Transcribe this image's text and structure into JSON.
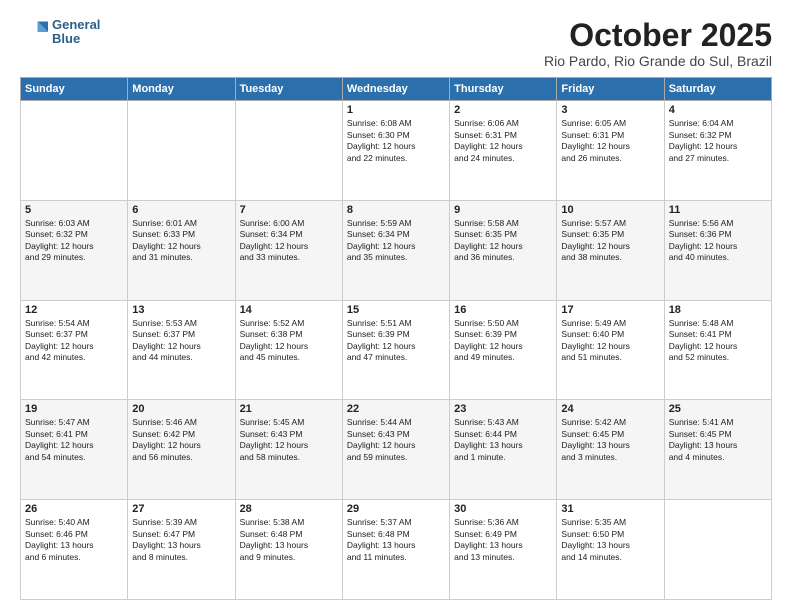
{
  "header": {
    "logo_line1": "General",
    "logo_line2": "Blue",
    "month": "October 2025",
    "location": "Rio Pardo, Rio Grande do Sul, Brazil"
  },
  "days_of_week": [
    "Sunday",
    "Monday",
    "Tuesday",
    "Wednesday",
    "Thursday",
    "Friday",
    "Saturday"
  ],
  "weeks": [
    [
      {
        "num": "",
        "text": ""
      },
      {
        "num": "",
        "text": ""
      },
      {
        "num": "",
        "text": ""
      },
      {
        "num": "1",
        "text": "Sunrise: 6:08 AM\nSunset: 6:30 PM\nDaylight: 12 hours\nand 22 minutes."
      },
      {
        "num": "2",
        "text": "Sunrise: 6:06 AM\nSunset: 6:31 PM\nDaylight: 12 hours\nand 24 minutes."
      },
      {
        "num": "3",
        "text": "Sunrise: 6:05 AM\nSunset: 6:31 PM\nDaylight: 12 hours\nand 26 minutes."
      },
      {
        "num": "4",
        "text": "Sunrise: 6:04 AM\nSunset: 6:32 PM\nDaylight: 12 hours\nand 27 minutes."
      }
    ],
    [
      {
        "num": "5",
        "text": "Sunrise: 6:03 AM\nSunset: 6:32 PM\nDaylight: 12 hours\nand 29 minutes."
      },
      {
        "num": "6",
        "text": "Sunrise: 6:01 AM\nSunset: 6:33 PM\nDaylight: 12 hours\nand 31 minutes."
      },
      {
        "num": "7",
        "text": "Sunrise: 6:00 AM\nSunset: 6:34 PM\nDaylight: 12 hours\nand 33 minutes."
      },
      {
        "num": "8",
        "text": "Sunrise: 5:59 AM\nSunset: 6:34 PM\nDaylight: 12 hours\nand 35 minutes."
      },
      {
        "num": "9",
        "text": "Sunrise: 5:58 AM\nSunset: 6:35 PM\nDaylight: 12 hours\nand 36 minutes."
      },
      {
        "num": "10",
        "text": "Sunrise: 5:57 AM\nSunset: 6:35 PM\nDaylight: 12 hours\nand 38 minutes."
      },
      {
        "num": "11",
        "text": "Sunrise: 5:56 AM\nSunset: 6:36 PM\nDaylight: 12 hours\nand 40 minutes."
      }
    ],
    [
      {
        "num": "12",
        "text": "Sunrise: 5:54 AM\nSunset: 6:37 PM\nDaylight: 12 hours\nand 42 minutes."
      },
      {
        "num": "13",
        "text": "Sunrise: 5:53 AM\nSunset: 6:37 PM\nDaylight: 12 hours\nand 44 minutes."
      },
      {
        "num": "14",
        "text": "Sunrise: 5:52 AM\nSunset: 6:38 PM\nDaylight: 12 hours\nand 45 minutes."
      },
      {
        "num": "15",
        "text": "Sunrise: 5:51 AM\nSunset: 6:39 PM\nDaylight: 12 hours\nand 47 minutes."
      },
      {
        "num": "16",
        "text": "Sunrise: 5:50 AM\nSunset: 6:39 PM\nDaylight: 12 hours\nand 49 minutes."
      },
      {
        "num": "17",
        "text": "Sunrise: 5:49 AM\nSunset: 6:40 PM\nDaylight: 12 hours\nand 51 minutes."
      },
      {
        "num": "18",
        "text": "Sunrise: 5:48 AM\nSunset: 6:41 PM\nDaylight: 12 hours\nand 52 minutes."
      }
    ],
    [
      {
        "num": "19",
        "text": "Sunrise: 5:47 AM\nSunset: 6:41 PM\nDaylight: 12 hours\nand 54 minutes."
      },
      {
        "num": "20",
        "text": "Sunrise: 5:46 AM\nSunset: 6:42 PM\nDaylight: 12 hours\nand 56 minutes."
      },
      {
        "num": "21",
        "text": "Sunrise: 5:45 AM\nSunset: 6:43 PM\nDaylight: 12 hours\nand 58 minutes."
      },
      {
        "num": "22",
        "text": "Sunrise: 5:44 AM\nSunset: 6:43 PM\nDaylight: 12 hours\nand 59 minutes."
      },
      {
        "num": "23",
        "text": "Sunrise: 5:43 AM\nSunset: 6:44 PM\nDaylight: 13 hours\nand 1 minute."
      },
      {
        "num": "24",
        "text": "Sunrise: 5:42 AM\nSunset: 6:45 PM\nDaylight: 13 hours\nand 3 minutes."
      },
      {
        "num": "25",
        "text": "Sunrise: 5:41 AM\nSunset: 6:45 PM\nDaylight: 13 hours\nand 4 minutes."
      }
    ],
    [
      {
        "num": "26",
        "text": "Sunrise: 5:40 AM\nSunset: 6:46 PM\nDaylight: 13 hours\nand 6 minutes."
      },
      {
        "num": "27",
        "text": "Sunrise: 5:39 AM\nSunset: 6:47 PM\nDaylight: 13 hours\nand 8 minutes."
      },
      {
        "num": "28",
        "text": "Sunrise: 5:38 AM\nSunset: 6:48 PM\nDaylight: 13 hours\nand 9 minutes."
      },
      {
        "num": "29",
        "text": "Sunrise: 5:37 AM\nSunset: 6:48 PM\nDaylight: 13 hours\nand 11 minutes."
      },
      {
        "num": "30",
        "text": "Sunrise: 5:36 AM\nSunset: 6:49 PM\nDaylight: 13 hours\nand 13 minutes."
      },
      {
        "num": "31",
        "text": "Sunrise: 5:35 AM\nSunset: 6:50 PM\nDaylight: 13 hours\nand 14 minutes."
      },
      {
        "num": "",
        "text": ""
      }
    ]
  ]
}
